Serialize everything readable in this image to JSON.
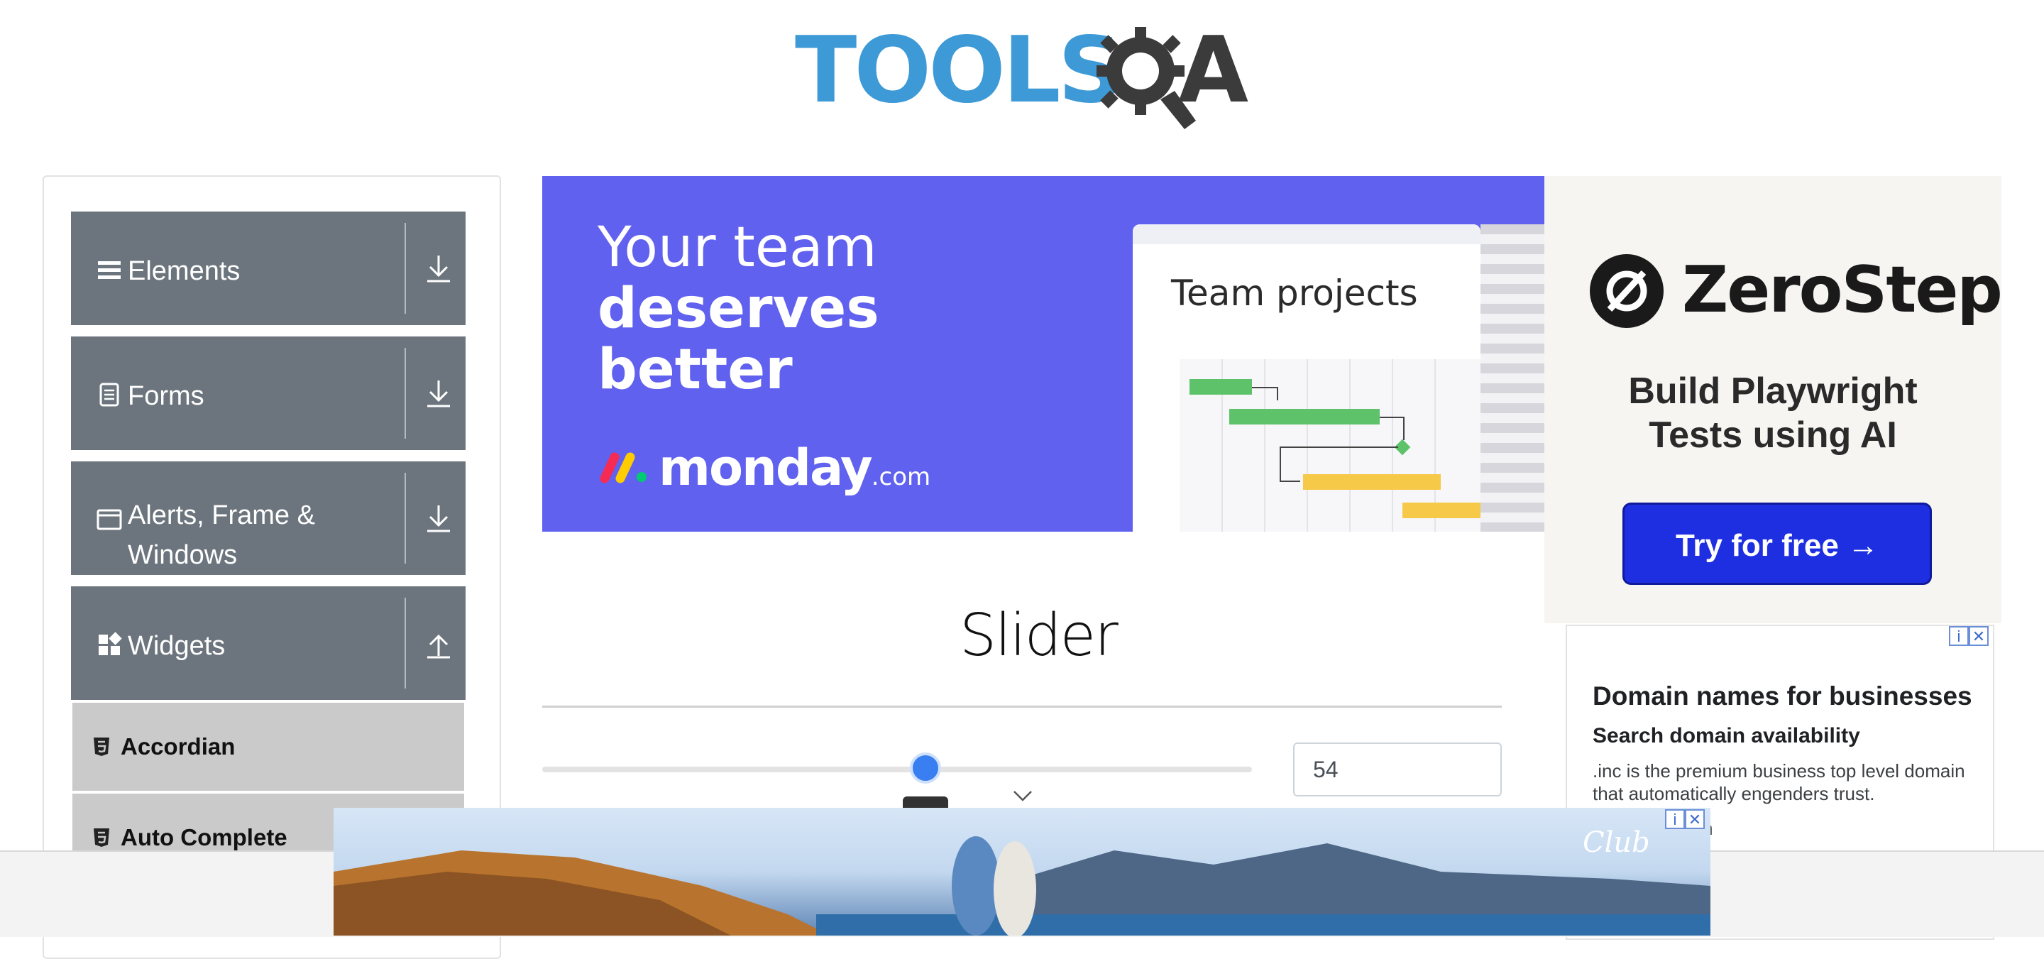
{
  "header": {
    "logo_text": "TOOLS",
    "logo_a": "A"
  },
  "sidebar": {
    "groups": [
      {
        "label": "Elements",
        "icon": "hamburger-icon",
        "arrow": "download-icon"
      },
      {
        "label": "Forms",
        "icon": "document-icon",
        "arrow": "download-icon"
      },
      {
        "label": "Alerts, Frame & Windows",
        "icon": "window-icon",
        "arrow": "download-icon"
      },
      {
        "label": "Widgets",
        "icon": "widgets-icon",
        "arrow": "upload-icon"
      }
    ],
    "items": [
      {
        "label": "Accordian",
        "icon": "html5-icon"
      },
      {
        "label": "Auto Complete",
        "icon": "html5-icon"
      }
    ]
  },
  "monday_ad": {
    "line1": "Your team",
    "line2": "deserves",
    "line3": "better",
    "brand": "monday",
    "brand_suffix": ".com",
    "card_title": "Team projects",
    "bg_color": "#6161ef"
  },
  "zerostep_ad": {
    "name": "ZeroStep",
    "tagline_1": "Build Playwright",
    "tagline_2": "Tests using AI",
    "button": "Try for free →",
    "button_color": "#1d2fe0"
  },
  "domain_ad": {
    "title": "Domain names for businesses",
    "subtitle": "Search domain availability",
    "text": ".inc is the premium business top level domain that automatically engenders trust.",
    "url_fragment": "m"
  },
  "main": {
    "title": "Slider",
    "slider_value": 54,
    "slider_value_text": "54",
    "slider_min": 0,
    "slider_max": 100
  },
  "bottom_ad": {
    "brand": "Club"
  },
  "colors": {
    "accent": "#3a7ff2",
    "sidebar_group": "#6c757d",
    "sidebar_item": "#cacaca"
  }
}
